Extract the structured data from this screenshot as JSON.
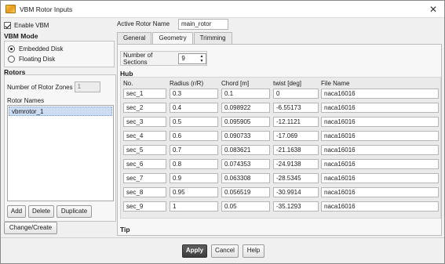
{
  "window": {
    "title": "VBM Rotor Inputs"
  },
  "left": {
    "enable_vbm_label": "Enable VBM",
    "vbm_mode_title": "VBM Mode",
    "mode_options": [
      "Embedded Disk",
      "Floating Disk"
    ],
    "selected_mode": "Embedded Disk",
    "rotors_title": "Rotors",
    "num_zones_label": "Number of Rotor Zones",
    "num_zones_value": "1",
    "rotor_names_label": "Rotor Names",
    "rotor_names": [
      "vbmrotor_1"
    ],
    "add_label": "Add",
    "delete_label": "Delete",
    "duplicate_label": "Duplicate",
    "change_create_label": "Change/Create"
  },
  "active_rotor": {
    "label": "Active Rotor Name",
    "value": "main_rotor"
  },
  "tabs": [
    {
      "label": "General",
      "active": false
    },
    {
      "label": "Geometry",
      "active": true
    },
    {
      "label": "Trimming",
      "active": false
    }
  ],
  "geometry": {
    "num_sections_label": "Number of Sections",
    "num_sections_value": "9",
    "hub_label": "Hub",
    "tip_label": "Tip",
    "columns": [
      "No.",
      "Radius (r/R)",
      "Chord [m]",
      "twist [deg]",
      "File Name"
    ],
    "rows": [
      [
        "sec_1",
        "0.3",
        "0.1",
        "0",
        "naca16016"
      ],
      [
        "sec_2",
        "0.4",
        "0.098922",
        "-6.55173",
        "naca16016"
      ],
      [
        "sec_3",
        "0.5",
        "0.095905",
        "-12.1121",
        "naca16016"
      ],
      [
        "sec_4",
        "0.6",
        "0.090733",
        "-17.069",
        "naca16016"
      ],
      [
        "sec_5",
        "0.7",
        "0.083621",
        "-21.1638",
        "naca16016"
      ],
      [
        "sec_6",
        "0.8",
        "0.074353",
        "-24.9138",
        "naca16016"
      ],
      [
        "sec_7",
        "0.9",
        "0.063308",
        "-28.5345",
        "naca16016"
      ],
      [
        "sec_8",
        "0.95",
        "0.056519",
        "-30.9914",
        "naca16016"
      ],
      [
        "sec_9",
        "1",
        "0.05",
        "-35.1293",
        "naca16016"
      ]
    ]
  },
  "footer": {
    "apply_label": "Apply",
    "cancel_label": "Cancel",
    "help_label": "Help"
  }
}
